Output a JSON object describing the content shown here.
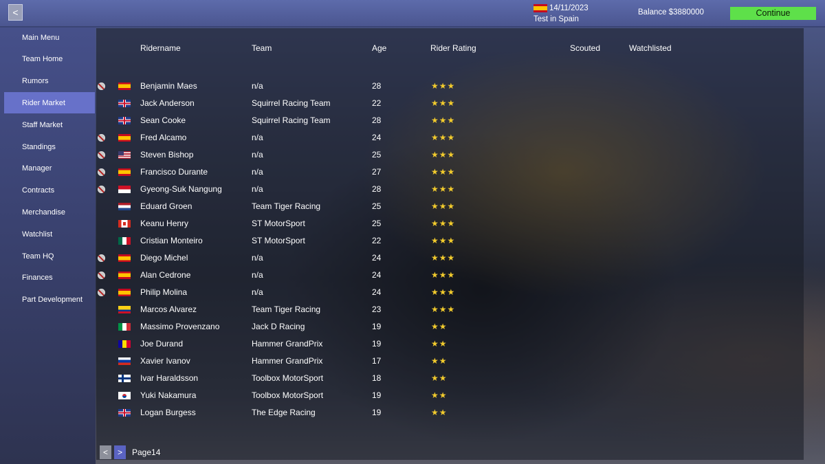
{
  "topbar": {
    "back_label": "<",
    "date": "14/11/2023",
    "location": "Test in Spain",
    "balance": "Balance $3880000",
    "continue_label": "Continue"
  },
  "sidebar": {
    "items": [
      {
        "label": "Main Menu",
        "active": false
      },
      {
        "label": "Team Home",
        "active": false
      },
      {
        "label": "Rumors",
        "active": false
      },
      {
        "label": "Rider Market",
        "active": true
      },
      {
        "label": "Staff Market",
        "active": false
      },
      {
        "label": "Standings",
        "active": false
      },
      {
        "label": "Manager",
        "active": false
      },
      {
        "label": "Contracts",
        "active": false
      },
      {
        "label": "Merchandise",
        "active": false
      },
      {
        "label": "Watchlist",
        "active": false
      },
      {
        "label": "Team HQ",
        "active": false
      },
      {
        "label": "Finances",
        "active": false
      },
      {
        "label": "Part Development",
        "active": false
      }
    ]
  },
  "table": {
    "headers": {
      "name": "Ridername",
      "team": "Team",
      "age": "Age",
      "rating": "Rider Rating",
      "scouted": "Scouted",
      "watchlisted": "Watchlisted"
    },
    "rows": [
      {
        "status": true,
        "flag": "es",
        "name": "Benjamin Maes",
        "team": "n/a",
        "age": "28",
        "rating": "★★★"
      },
      {
        "status": false,
        "flag": "gb",
        "name": "Jack Anderson",
        "team": "Squirrel Racing Team",
        "age": "22",
        "rating": "★★★"
      },
      {
        "status": false,
        "flag": "gb",
        "name": "Sean Cooke",
        "team": "Squirrel Racing Team",
        "age": "28",
        "rating": "★★★"
      },
      {
        "status": true,
        "flag": "es",
        "name": "Fred Alcamo",
        "team": "n/a",
        "age": "24",
        "rating": "★★★"
      },
      {
        "status": true,
        "flag": "us",
        "name": "Steven Bishop",
        "team": "n/a",
        "age": "25",
        "rating": "★★★"
      },
      {
        "status": true,
        "flag": "es",
        "name": "Francisco Durante",
        "team": "n/a",
        "age": "27",
        "rating": "★★★"
      },
      {
        "status": true,
        "flag": "id",
        "name": "Gyeong-Suk Nangung",
        "team": "n/a",
        "age": "28",
        "rating": "★★★"
      },
      {
        "status": false,
        "flag": "nl",
        "name": "Eduard Groen",
        "team": "Team Tiger Racing",
        "age": "25",
        "rating": "★★★"
      },
      {
        "status": false,
        "flag": "ca",
        "name": "Keanu Henry",
        "team": "ST MotorSport",
        "age": "25",
        "rating": "★★★"
      },
      {
        "status": false,
        "flag": "mx",
        "name": "Cristian Monteiro",
        "team": "ST MotorSport",
        "age": "22",
        "rating": "★★★"
      },
      {
        "status": true,
        "flag": "es",
        "name": "Diego Michel",
        "team": "n/a",
        "age": "24",
        "rating": "★★★"
      },
      {
        "status": true,
        "flag": "es",
        "name": "Alan Cedrone",
        "team": "n/a",
        "age": "24",
        "rating": "★★★"
      },
      {
        "status": true,
        "flag": "es",
        "name": "Philip Molina",
        "team": "n/a",
        "age": "24",
        "rating": "★★★"
      },
      {
        "status": false,
        "flag": "co",
        "name": "Marcos Alvarez",
        "team": "Team Tiger Racing",
        "age": "23",
        "rating": "★★★"
      },
      {
        "status": false,
        "flag": "it",
        "name": "Massimo Provenzano",
        "team": "Jack D Racing",
        "age": "19",
        "rating": "★★"
      },
      {
        "status": false,
        "flag": "ad",
        "name": "Joe Durand",
        "team": "Hammer GrandPrix",
        "age": "19",
        "rating": "★★"
      },
      {
        "status": false,
        "flag": "ru",
        "name": "Xavier Ivanov",
        "team": "Hammer GrandPrix",
        "age": "17",
        "rating": "★★"
      },
      {
        "status": false,
        "flag": "fi",
        "name": "Ivar Haraldsson",
        "team": "Toolbox MotorSport",
        "age": "18",
        "rating": "★★"
      },
      {
        "status": false,
        "flag": "kr",
        "name": "Yuki Nakamura",
        "team": "Toolbox MotorSport",
        "age": "19",
        "rating": "★★"
      },
      {
        "status": false,
        "flag": "gb",
        "name": "Logan Burgess",
        "team": "The Edge Racing",
        "age": "19",
        "rating": "★★"
      }
    ]
  },
  "pagination": {
    "prev_label": "<",
    "next_label": ">",
    "page_label": "Page14"
  }
}
